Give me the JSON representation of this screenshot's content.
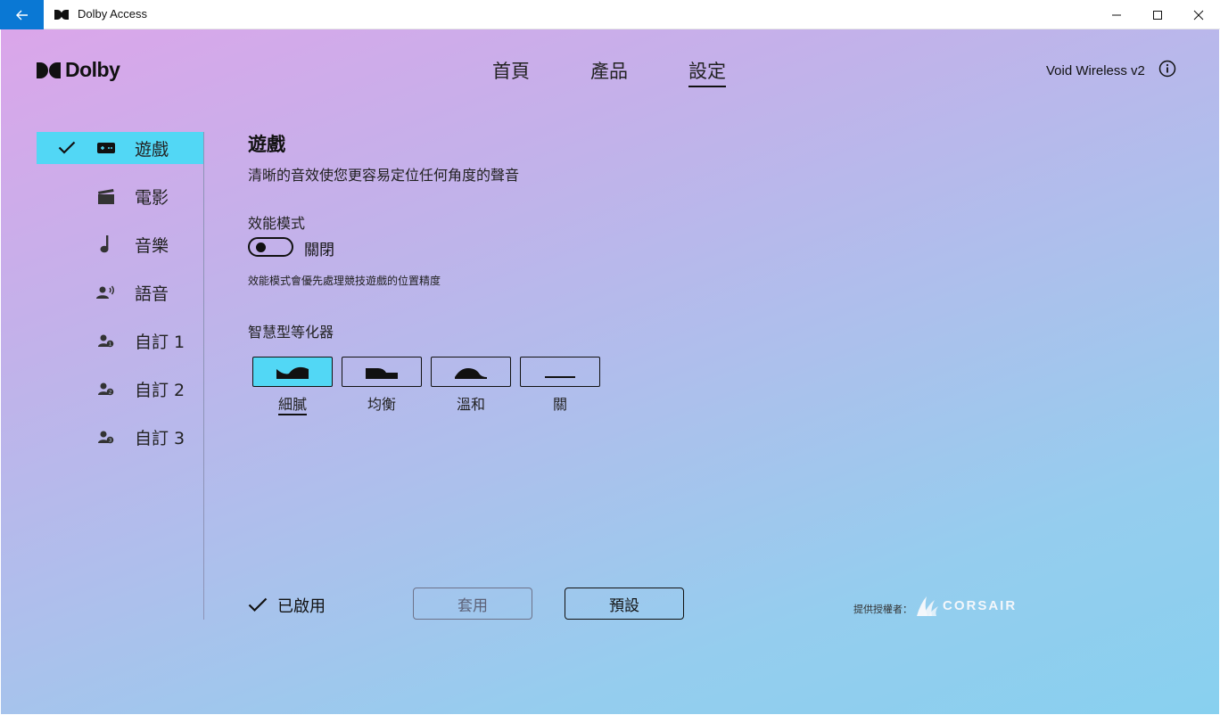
{
  "window": {
    "title": "Dolby Access"
  },
  "brand": {
    "name": "Dolby"
  },
  "nav": {
    "tabs": [
      {
        "label": "首頁"
      },
      {
        "label": "產品"
      },
      {
        "label": "設定",
        "active": true
      }
    ]
  },
  "device": {
    "name": "Void Wireless v2"
  },
  "sidebar": {
    "items": [
      {
        "label": "遊戲",
        "icon": "gamepad-icon",
        "active": true,
        "checked": true
      },
      {
        "label": "電影",
        "icon": "movie-clapper-icon"
      },
      {
        "label": "音樂",
        "icon": "music-note-icon"
      },
      {
        "label": "語音",
        "icon": "voice-icon"
      },
      {
        "label": "自訂 1",
        "icon": "custom-profile-1-icon"
      },
      {
        "label": "自訂 2",
        "icon": "custom-profile-2-icon"
      },
      {
        "label": "自訂 3",
        "icon": "custom-profile-3-icon"
      }
    ]
  },
  "content": {
    "title": "遊戲",
    "description": "清晰的音效使您更容易定位任何角度的聲音",
    "performance": {
      "label": "效能模式",
      "state_label": "關閉",
      "enabled": false,
      "note": "效能模式會優先處理競技遊戲的位置精度"
    },
    "equalizer": {
      "label": "智慧型等化器",
      "options": [
        {
          "label": "細膩",
          "selected": true
        },
        {
          "label": "均衡"
        },
        {
          "label": "溫和"
        },
        {
          "label": "關"
        }
      ]
    }
  },
  "footer": {
    "enabled_label": "已啟用",
    "apply_label": "套用",
    "default_label": "預設",
    "provided_by": "提供授權者：",
    "partner": "CORSAIR"
  },
  "colors": {
    "accent": "#52d7f5",
    "titlebar_back": "#0a78d4"
  }
}
